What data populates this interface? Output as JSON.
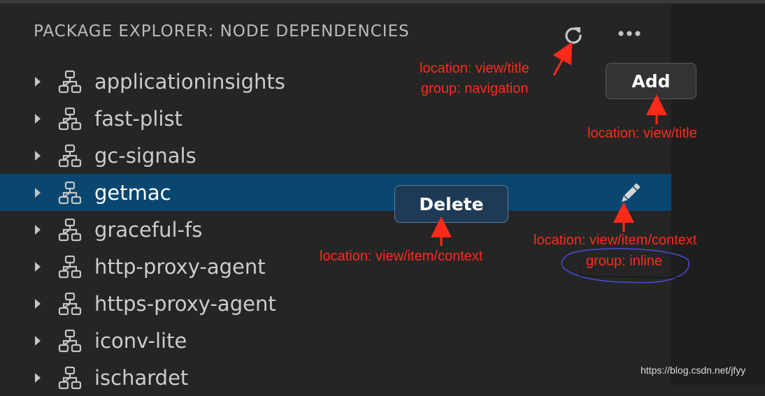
{
  "panel": {
    "title": "PACKAGE EXPLORER: NODE DEPENDENCIES"
  },
  "title_actions": [
    {
      "icon": "refresh-icon"
    },
    {
      "icon": "more-icon"
    }
  ],
  "tree": {
    "items": [
      {
        "label": "applicationinsights",
        "icon": "dependency-icon",
        "selected": false
      },
      {
        "label": "fast-plist",
        "icon": "dependency-icon",
        "selected": false
      },
      {
        "label": "gc-signals",
        "icon": "dependency-icon",
        "selected": false
      },
      {
        "label": "getmac",
        "icon": "dependency-icon",
        "selected": true
      },
      {
        "label": "graceful-fs",
        "icon": "dependency-icon",
        "selected": false
      },
      {
        "label": "http-proxy-agent",
        "icon": "dependency-icon",
        "selected": false
      },
      {
        "label": "https-proxy-agent",
        "icon": "dependency-icon",
        "selected": false
      },
      {
        "label": "iconv-lite",
        "icon": "dependency-icon",
        "selected": false
      },
      {
        "label": "ischardet",
        "icon": "dependency-icon",
        "selected": false
      }
    ]
  },
  "buttons": {
    "add_label": "Add",
    "delete_label": "Delete"
  },
  "annotations": {
    "refresh_location": "location: view/title",
    "refresh_group": "group: navigation",
    "add_location": "location: view/title",
    "delete_location": "location: view/item/context",
    "edit_location": "location: view/item/context",
    "edit_group": "group: inline"
  },
  "watermark": "https://blog.csdn.net/jfyy",
  "colors": {
    "background": "#252526",
    "selection": "#094771",
    "annotation_red": "#ff2a1a",
    "circle_blue": "#4a4ad8"
  }
}
